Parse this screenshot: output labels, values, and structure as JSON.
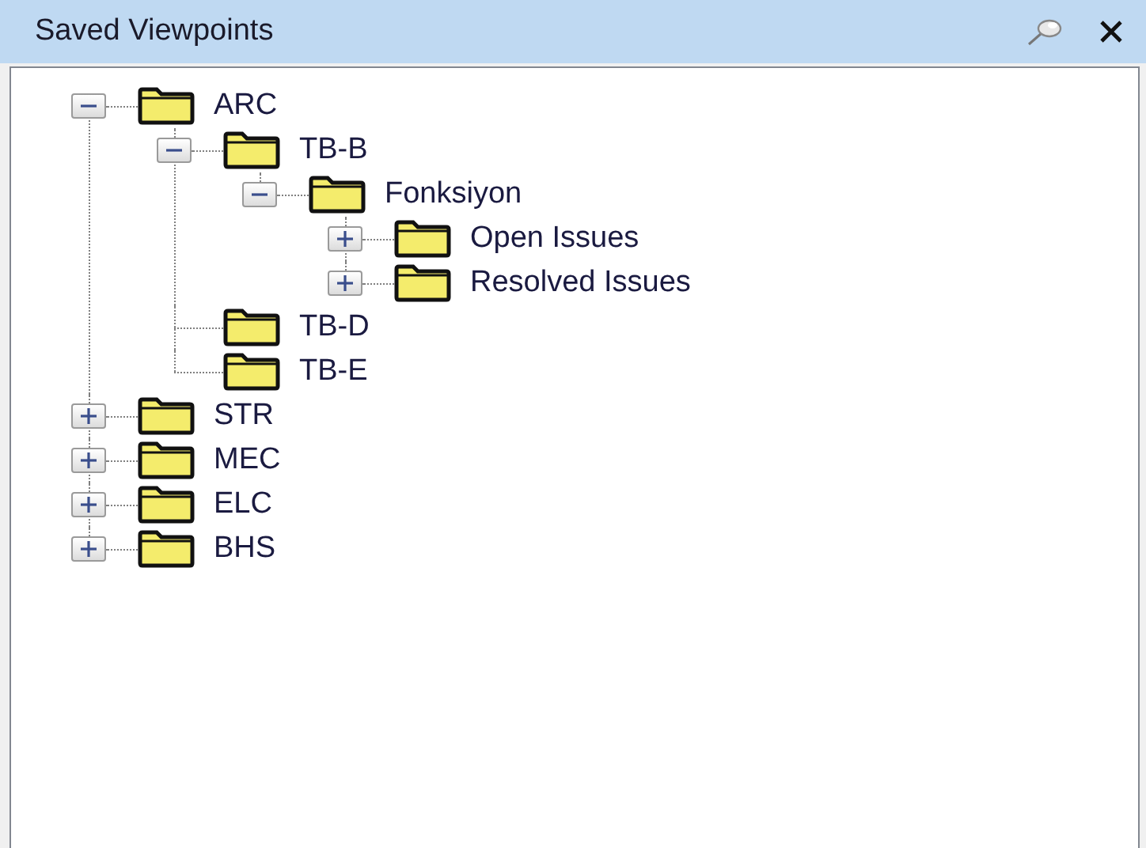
{
  "panel": {
    "title": "Saved Viewpoints"
  },
  "tree": [
    {
      "label": "ARC",
      "expanded": true,
      "children": [
        {
          "label": "TB-B",
          "expanded": true,
          "children": [
            {
              "label": "Fonksiyon",
              "expanded": true,
              "children": [
                {
                  "label": "Open Issues",
                  "expanded": false
                },
                {
                  "label": "Resolved Issues",
                  "expanded": false
                }
              ]
            }
          ]
        },
        {
          "label": "TB-D"
        },
        {
          "label": "TB-E"
        }
      ]
    },
    {
      "label": "STR",
      "expanded": false
    },
    {
      "label": "MEC",
      "expanded": false
    },
    {
      "label": "ELC",
      "expanded": false
    },
    {
      "label": "BHS",
      "expanded": false
    }
  ]
}
